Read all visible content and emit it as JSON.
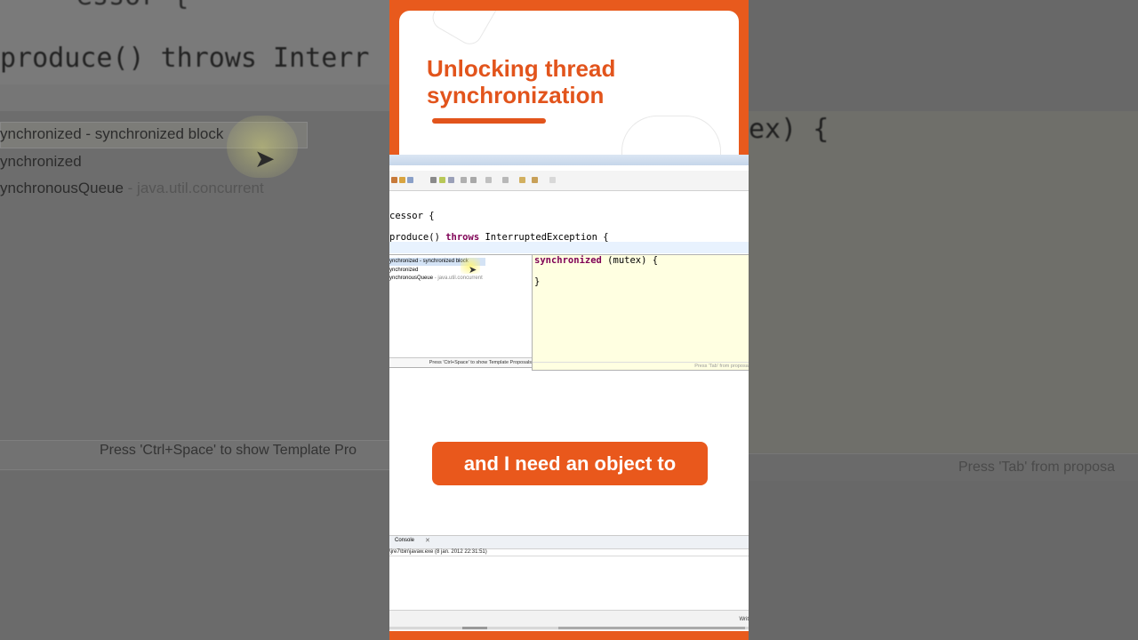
{
  "background": {
    "left_code_line1": "essor {",
    "left_code_line2": "produce() throws Interr",
    "left_proposals": [
      {
        "text": "ynchronized - synchronized block"
      },
      {
        "text": "ynchronized"
      },
      {
        "text": "ynchronousQueue",
        "pkg": " - java.util.concurrent"
      }
    ],
    "left_footer": "Press 'Ctrl+Space' to show Template Pro",
    "right_code": "ex) {",
    "right_footer": "Press 'Tab' from proposa"
  },
  "card": {
    "title_line1": "Unlocking thread",
    "title_line2": "synchronization"
  },
  "editor": {
    "line_class": "cessor {",
    "line_method_pre": "produce() ",
    "line_method_kw": "throws",
    "line_method_post": " InterruptedException {"
  },
  "proposals": {
    "items": [
      {
        "text": "ynchronized - synchronized block"
      },
      {
        "text": "ynchronized"
      },
      {
        "text": "ynchronousQueue",
        "pkg": " - java.util.concurrent"
      }
    ],
    "footer": "Press 'Ctrl+Space' to show Template Proposals"
  },
  "preview": {
    "kw": "synchronized",
    "rest": " (mutex) {",
    "close": "}",
    "footer": "Press 'Tab' from proposal"
  },
  "caption": "and I need an object to",
  "console": {
    "tab_label": "Console",
    "close_glyph": "✕",
    "line": "\\jre7\\bin\\javaw.exe (8 jan. 2012 22:31:51)"
  },
  "status": {
    "text": "Writ"
  },
  "colors": {
    "accent": "#e85a1d",
    "keyword": "#7f0055",
    "preview_bg": "#ffffe1"
  }
}
